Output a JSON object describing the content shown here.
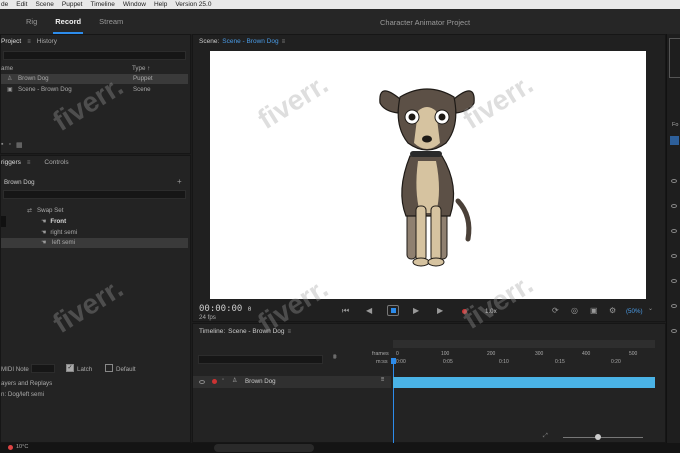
{
  "menu": [
    "de",
    "Edit",
    "Scene",
    "Puppet",
    "Timeline",
    "Window",
    "Help",
    "Version 25.0"
  ],
  "workspaces": [
    {
      "label": "Rig",
      "active": false
    },
    {
      "label": "Record",
      "active": true
    },
    {
      "label": "Stream",
      "active": false
    }
  ],
  "project_title": "Character Animator Project",
  "project_panel": {
    "tabs": [
      "Project",
      "History"
    ],
    "columns": {
      "name": "ame",
      "type": "Type"
    },
    "items": [
      {
        "name": "Brown Dog",
        "type": "Puppet"
      },
      {
        "name": "Scene - Brown Dog",
        "type": "Scene"
      }
    ]
  },
  "triggers_panel": {
    "tabs": [
      "riggers",
      "Controls"
    ],
    "puppet": "Brown Dog",
    "swap_set": "Swap Set",
    "swap_items": [
      "Front",
      "right semi",
      "left semi"
    ],
    "midi_label": "MIDI Note",
    "latch_label": "Latch",
    "default_label": "Default",
    "layers_label": "ayers and Replays",
    "path_label": "n: Dog/left semi"
  },
  "scene_panel": {
    "label": "Scene:",
    "name": "Scene - Brown Dog",
    "timecode": "00:00:00",
    "timecode_suffix": "0",
    "fps": "24 fps",
    "speed": "1.0x",
    "zoom": "(50%)"
  },
  "timeline_panel": {
    "label": "Timeline:",
    "name": "Scene - Brown Dog",
    "frames_label": "frames",
    "mss_label": "m:ss",
    "frame_ticks": [
      "0",
      "100",
      "200",
      "300",
      "400",
      "500"
    ],
    "time_ticks": [
      "0:00",
      "0:05",
      "0:10",
      "0:15",
      "0:20"
    ],
    "track": "Brown Dog"
  },
  "right_panel": {
    "label": "Fo"
  },
  "watermark": "fiverr.",
  "taskbar": {
    "weather": "10°C"
  },
  "colors": {
    "accent": "#2d8ceb",
    "track": "#4ab3e6",
    "record": "#cc3333"
  }
}
